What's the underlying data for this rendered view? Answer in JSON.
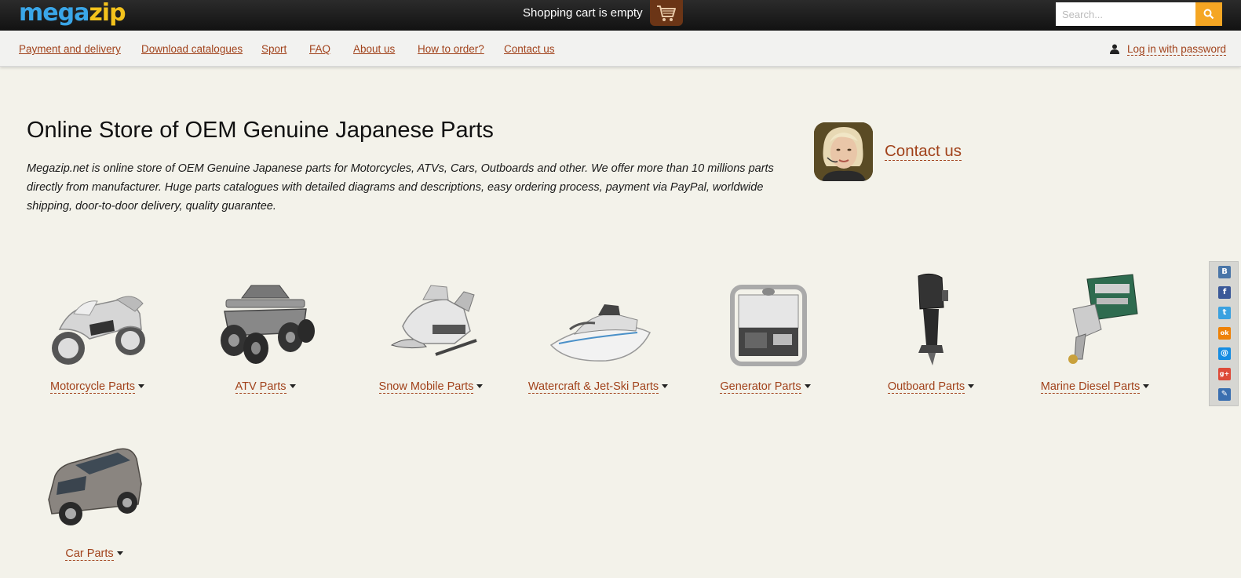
{
  "header": {
    "logo_part1": "mega",
    "logo_part2": "zip",
    "cart_text": "Shopping cart is empty",
    "cart_icon": "shopping-cart-icon",
    "search_placeholder": "Search...",
    "search_icon": "search-icon"
  },
  "nav": {
    "items": [
      "Payment and delivery",
      "Download catalogues",
      "Sport",
      "FAQ",
      "About us",
      "How to order?",
      "Contact us"
    ],
    "login_label": "Log in with password",
    "login_icon": "user-icon"
  },
  "hero": {
    "title": "Online Store of OEM Genuine Japanese Parts",
    "description": "Megazip.net is online store of OEM Genuine Japanese parts for Motorcycles, ATVs, Cars, Outboards and other. We offer more than 10 millions parts directly from manufacturer. Huge parts catalogues with detailed diagrams and descriptions, easy ordering process, payment via PayPal, worldwide shipping, door-to-door delivery, quality guarantee.",
    "contact_label": "Contact us"
  },
  "categories": [
    {
      "label": "Motorcycle Parts",
      "icon": "motorcycle-icon"
    },
    {
      "label": "ATV Parts",
      "icon": "atv-icon"
    },
    {
      "label": "Snow Mobile Parts",
      "icon": "snowmobile-icon"
    },
    {
      "label": "Watercraft & Jet-Ski Parts",
      "icon": "jetski-icon"
    },
    {
      "label": "Generator Parts",
      "icon": "generator-icon"
    },
    {
      "label": "Outboard Parts",
      "icon": "outboard-motor-icon"
    },
    {
      "label": "Marine Diesel Parts",
      "icon": "marine-diesel-icon"
    },
    {
      "label": "Car Parts",
      "icon": "car-icon"
    }
  ],
  "social": [
    {
      "icon": "vk-icon",
      "glyph": "B",
      "color": "#4a76a8"
    },
    {
      "icon": "facebook-icon",
      "glyph": "f",
      "color": "#3b5998"
    },
    {
      "icon": "twitter-icon",
      "glyph": "t",
      "color": "#3aa1e0"
    },
    {
      "icon": "odnoklassniki-icon",
      "glyph": "ok",
      "color": "#ee8208"
    },
    {
      "icon": "mail-icon",
      "glyph": "@",
      "color": "#168de2"
    },
    {
      "icon": "google-plus-icon",
      "glyph": "g+",
      "color": "#dd4b39"
    },
    {
      "icon": "bookmark-icon",
      "glyph": "✎",
      "color": "#3a6fb0"
    }
  ],
  "colors": {
    "link": "#a1421b",
    "accent": "#f5a623",
    "background": "#f3f2ea"
  }
}
